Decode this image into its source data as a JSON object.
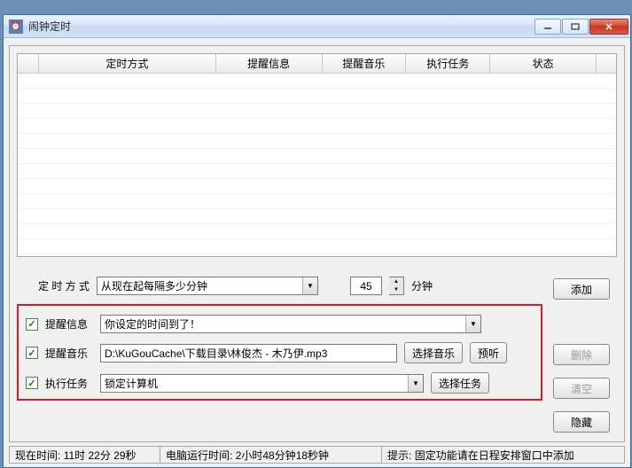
{
  "window": {
    "title": "闹钟定时"
  },
  "grid": {
    "headers": [
      "",
      "定时方式",
      "提醒信息",
      "提醒音乐",
      "执行任务",
      "状态",
      ""
    ]
  },
  "timing": {
    "label": "定时方式",
    "mode_value": "从现在起每隔多少分钟",
    "number_value": "45",
    "unit": "分钟"
  },
  "reminder_info": {
    "label": "提醒信息",
    "value": "你设定的时间到了！"
  },
  "reminder_music": {
    "label": "提醒音乐",
    "value": "D:\\KuGouCache\\下载目录\\林俊杰 - 木乃伊.mp3",
    "choose_btn": "选择音乐",
    "preview_btn": "预听"
  },
  "task": {
    "label": "执行任务",
    "value": "锁定计算机",
    "choose_btn": "选择任务"
  },
  "buttons": {
    "add": "添加",
    "delete": "删除",
    "clear": "清空",
    "hide": "隐藏"
  },
  "status": {
    "now_label": "现在时间:",
    "now_value": "11时 22分 29秒",
    "uptime_label": "电脑运行时间:",
    "uptime_value": "2小时48分钟18秒钟",
    "tip_label": "提示:",
    "tip_value": "固定功能请在日程安排窗口中添加"
  }
}
